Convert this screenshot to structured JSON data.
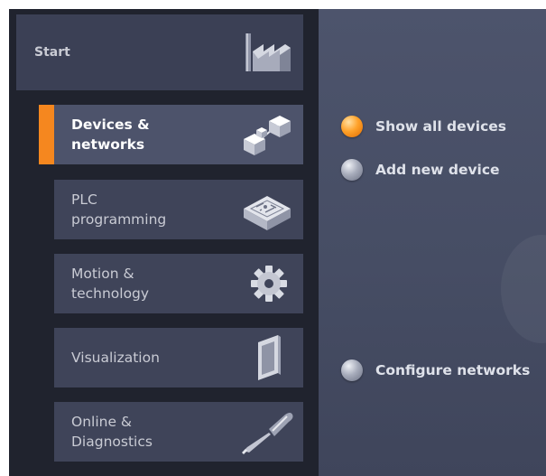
{
  "sidebar": {
    "start_label": "Start",
    "items": [
      {
        "label_line1": "Devices &",
        "label_line2": "networks",
        "icon": "devices-networks-icon",
        "active": true
      },
      {
        "label_line1": "PLC",
        "label_line2": "programming",
        "icon": "plc-programming-icon",
        "active": false
      },
      {
        "label_line1": "Motion &",
        "label_line2": "technology",
        "icon": "gear-icon",
        "active": false
      },
      {
        "label_line1": "Visualization",
        "label_line2": "",
        "icon": "visualization-panel-icon",
        "active": false
      },
      {
        "label_line1": "Online &",
        "label_line2": "Diagnostics",
        "icon": "screwdriver-icon",
        "active": false
      }
    ]
  },
  "actions": [
    {
      "label": "Show all devices",
      "selected": true
    },
    {
      "label": "Add new device",
      "selected": false
    },
    {
      "label": "Configure networks",
      "selected": false
    }
  ],
  "colors": {
    "accent": "#f5871f",
    "background": "#20232e",
    "panel": "#464d64"
  }
}
